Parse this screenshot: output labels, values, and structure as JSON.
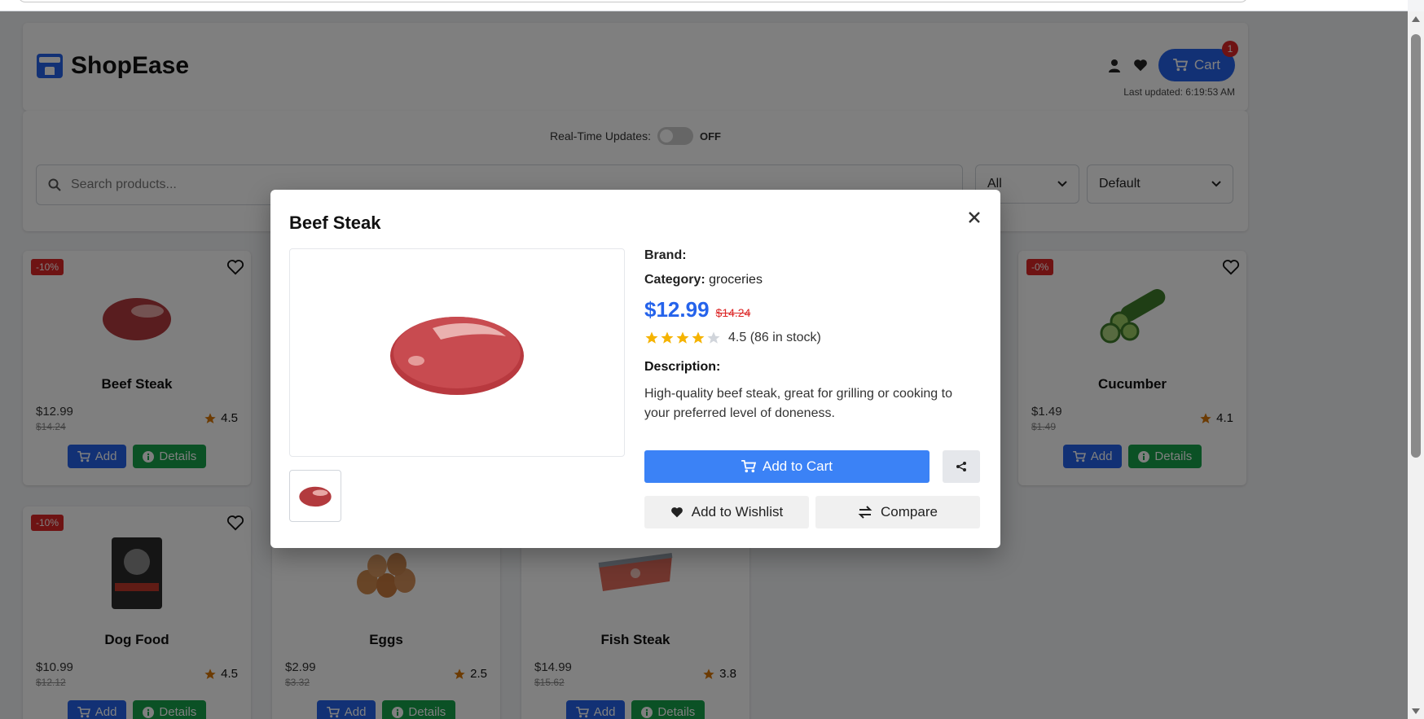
{
  "header": {
    "brand": "ShopEase",
    "cart_label": "Cart",
    "cart_count": "1",
    "last_updated": "Last updated: 6:19:53 AM"
  },
  "controls": {
    "realtime_label": "Real-Time Updates:",
    "realtime_state": "OFF",
    "search_placeholder": "Search products...",
    "category_selected": "All",
    "sort_selected": "Default"
  },
  "products": [
    {
      "name": "Beef Steak",
      "price": "$12.99",
      "old_price": "$14.24",
      "discount": "-10%",
      "rating": "4.5"
    },
    {
      "name": "Cucumber",
      "price": "$1.49",
      "old_price": "$1.49",
      "discount": "-0%",
      "rating": "4.1"
    },
    {
      "name": "Dog Food",
      "price": "$10.99",
      "old_price": "$12.12",
      "discount": "-10%",
      "rating": "4.5"
    },
    {
      "name": "Eggs",
      "price": "$2.99",
      "old_price": "$3.32",
      "discount": "",
      "rating": "2.5"
    },
    {
      "name": "Fish Steak",
      "price": "$14.99",
      "old_price": "$15.62",
      "discount": "",
      "rating": "3.8"
    }
  ],
  "card_buttons": {
    "add": "Add",
    "details": "Details"
  },
  "modal": {
    "title": "Beef Steak",
    "brand_label": "Brand:",
    "category_label": "Category:",
    "category_value": "groceries",
    "price": "$12.99",
    "old_price": "$14.24",
    "rating": 4.5,
    "rating_text": "4.5 (86 in stock)",
    "description_label": "Description:",
    "description": "High-quality beef steak, great for grilling or cooking to your preferred level of doneness.",
    "add_to_cart": "Add to Cart",
    "add_to_wishlist": "Add to Wishlist",
    "compare": "Compare"
  },
  "colors": {
    "primary": "#2563eb",
    "success": "#16a34a",
    "danger": "#dc2626",
    "star": "#f59e0b"
  }
}
